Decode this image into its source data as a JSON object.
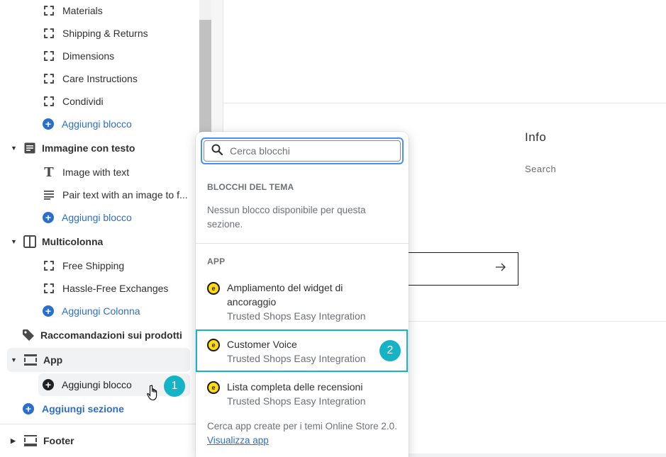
{
  "sidebar": {
    "block_items_top": [
      {
        "label": "Materials",
        "icon": "dashed-square-icon"
      },
      {
        "label": "Shipping & Returns",
        "icon": "dashed-square-icon"
      },
      {
        "label": "Dimensions",
        "icon": "dashed-square-icon"
      },
      {
        "label": "Care Instructions",
        "icon": "dashed-square-icon"
      },
      {
        "label": "Condividi",
        "icon": "dashed-square-icon"
      }
    ],
    "add_block_1": "Aggiungi blocco",
    "section_image_text": {
      "label": "Immagine con testo",
      "items": [
        {
          "label": "Image with text",
          "icon": "text-icon"
        },
        {
          "label": "Pair text with an image to f...",
          "icon": "paragraph-icon"
        }
      ],
      "add_label": "Aggiungi blocco"
    },
    "section_multicolumn": {
      "label": "Multicolonna",
      "items": [
        {
          "label": "Free Shipping",
          "icon": "dashed-square-icon"
        },
        {
          "label": "Hassle-Free Exchanges",
          "icon": "dashed-square-icon"
        }
      ],
      "add_label": "Aggiungi Colonna"
    },
    "section_recommendations": {
      "label": "Raccomandazioni sui prodotti"
    },
    "section_app": {
      "label": "App",
      "add_label": "Aggiungi blocco"
    },
    "add_section_label": "Aggiungi sezione",
    "footer_label": "Footer",
    "step_badge_1": "1"
  },
  "preview": {
    "info_title": "Info",
    "info_search": "Search"
  },
  "popover": {
    "search_placeholder": "Cerca blocchi",
    "theme_heading": "BLOCCHI DEL TEMA",
    "theme_empty": "Nessun blocco disponibile per questa sezione.",
    "app_heading": "APP",
    "apps": [
      {
        "name": "Ampliamento del widget di ancoraggio",
        "provider": "Trusted Shops Easy Integration"
      },
      {
        "name": "Customer Voice",
        "provider": "Trusted Shops Easy Integration"
      },
      {
        "name": "Lista completa delle recensioni",
        "provider": "Trusted Shops Easy Integration"
      }
    ],
    "footer_text": "Cerca app create per i temi Online Store 2.0.",
    "footer_link": "Visualizza app",
    "step_badge_2": "2"
  },
  "colors": {
    "accent_blue": "#2c6ecb",
    "badge_teal": "#14b3c6",
    "focus_blue": "#458fff",
    "trusted_yellow": "#ffdc0f"
  }
}
